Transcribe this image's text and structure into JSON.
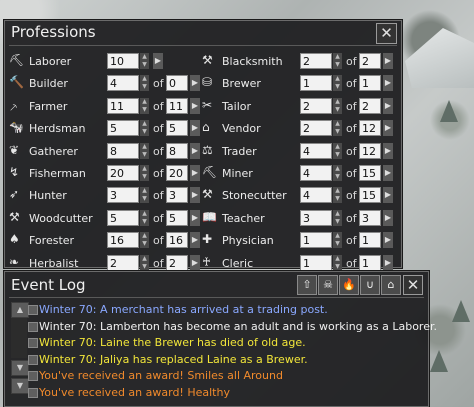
{
  "professions_panel": {
    "title": "Professions",
    "close_glyph": "✕",
    "left_column": [
      {
        "icon": "shovel-icon",
        "glyph": "⛏",
        "name": "Laborer",
        "count": "10",
        "of": "",
        "max": "",
        "has_arrow": true
      },
      {
        "icon": "hammer-icon",
        "glyph": "🔨",
        "name": "Builder",
        "count": "4",
        "of": "of",
        "max": "0",
        "has_arrow": true
      },
      {
        "icon": "hoe-icon",
        "glyph": "⸕",
        "name": "Farmer",
        "count": "11",
        "of": "of",
        "max": "11",
        "has_arrow": true
      },
      {
        "icon": "cow-icon",
        "glyph": "🐄",
        "name": "Herdsman",
        "count": "5",
        "of": "of",
        "max": "5",
        "has_arrow": true
      },
      {
        "icon": "plant-icon",
        "glyph": "❦",
        "name": "Gatherer",
        "count": "8",
        "of": "of",
        "max": "8",
        "has_arrow": true
      },
      {
        "icon": "fishing-rod-icon",
        "glyph": "↯",
        "name": "Fisherman",
        "count": "20",
        "of": "of",
        "max": "20",
        "has_arrow": true
      },
      {
        "icon": "bow-icon",
        "glyph": "➶",
        "name": "Hunter",
        "count": "3",
        "of": "of",
        "max": "3",
        "has_arrow": true
      },
      {
        "icon": "axe-icon",
        "glyph": "⚒",
        "name": "Woodcutter",
        "count": "5",
        "of": "of",
        "max": "5",
        "has_arrow": true
      },
      {
        "icon": "tree-icon",
        "glyph": "♠",
        "name": "Forester",
        "count": "16",
        "of": "of",
        "max": "16",
        "has_arrow": true
      },
      {
        "icon": "herb-icon",
        "glyph": "❧",
        "name": "Herbalist",
        "count": "2",
        "of": "of",
        "max": "2",
        "has_arrow": true
      }
    ],
    "right_column": [
      {
        "icon": "anvil-icon",
        "glyph": "⚒",
        "name": "Blacksmith",
        "count": "2",
        "of": "of",
        "max": "2",
        "has_arrow": true
      },
      {
        "icon": "barrel-icon",
        "glyph": "⛁",
        "name": "Brewer",
        "count": "1",
        "of": "of",
        "max": "1",
        "has_arrow": true
      },
      {
        "icon": "scissors-icon",
        "glyph": "✂",
        "name": "Tailor",
        "count": "2",
        "of": "of",
        "max": "2",
        "has_arrow": true
      },
      {
        "icon": "market-stall-icon",
        "glyph": "⌂",
        "name": "Vendor",
        "count": "2",
        "of": "of",
        "max": "12",
        "has_arrow": true
      },
      {
        "icon": "handshake-icon",
        "glyph": "⚖",
        "name": "Trader",
        "count": "4",
        "of": "of",
        "max": "12",
        "has_arrow": true
      },
      {
        "icon": "pickaxe-icon",
        "glyph": "⛏",
        "name": "Miner",
        "count": "4",
        "of": "of",
        "max": "15",
        "has_arrow": true
      },
      {
        "icon": "chisel-icon",
        "glyph": "⚒",
        "name": "Stonecutter",
        "count": "4",
        "of": "of",
        "max": "15",
        "has_arrow": true
      },
      {
        "icon": "book-icon",
        "glyph": "📖",
        "name": "Teacher",
        "count": "3",
        "of": "of",
        "max": "3",
        "has_arrow": true
      },
      {
        "icon": "medical-cross-icon",
        "glyph": "✚",
        "name": "Physician",
        "count": "1",
        "of": "of",
        "max": "1",
        "has_arrow": true
      },
      {
        "icon": "cleric-icon",
        "glyph": "♰",
        "name": "Cleric",
        "count": "1",
        "of": "of",
        "max": "1",
        "has_arrow": true
      }
    ]
  },
  "event_log": {
    "title": "Event Log",
    "filter_buttons": [
      {
        "icon": "population-arrow-icon",
        "glyph": "⇧"
      },
      {
        "icon": "skull-crossbones-icon",
        "glyph": "☠"
      },
      {
        "icon": "fire-icon",
        "glyph": "🔥"
      },
      {
        "icon": "cup-icon",
        "glyph": "∪"
      },
      {
        "icon": "house-icon",
        "glyph": "⌂"
      }
    ],
    "close_glyph": "✕",
    "scroll_up_glyph": "▲",
    "scroll_down_glyph": "▼",
    "entries": [
      {
        "text": "Winter 70: A merchant has arrived at a trading post.",
        "color": "#8aa8ff",
        "marker": true
      },
      {
        "text": "Winter 70: Lamberton has become an adult and is working as a Laborer.",
        "color": "#f0f0f0",
        "marker": true
      },
      {
        "text": "Winter 70: Laine the Brewer has died of old age.",
        "color": "#f2e63a",
        "marker": true
      },
      {
        "text": "Winter 70: Jaliya has replaced Laine as a Brewer.",
        "color": "#f2e63a",
        "marker": true
      },
      {
        "text": "You've received an award! Smiles all Around",
        "color": "#f08a2c",
        "marker": true
      },
      {
        "text": "You've received an award! Healthy",
        "color": "#f08a2c",
        "marker": true
      }
    ]
  }
}
